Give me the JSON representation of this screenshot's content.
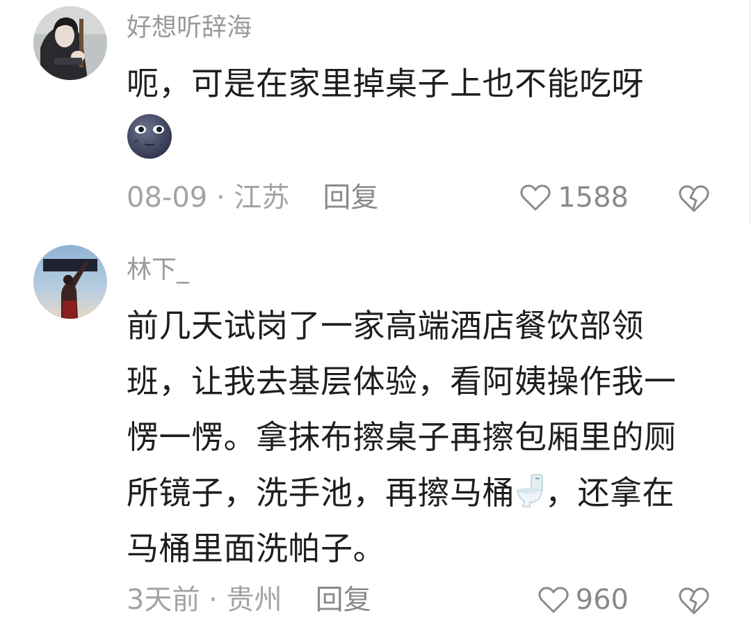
{
  "comments": [
    {
      "username": "好想听辞海",
      "avatar_icon": "avatar-girl-instrument",
      "text": "呃，可是在家里掉桌子上也不能吃呀",
      "emoji": "new-moon-face-emoji",
      "date": "08-09",
      "separator": " · ",
      "location": "江苏",
      "reply_label": "回复",
      "likes": "1588"
    },
    {
      "username": "林下_",
      "avatar_icon": "avatar-silhouette-sky",
      "text_before_emoji": "前几天试岗了一家高端酒店餐饮部领班，让我去基层体验，看阿姨操作我一愣一愣。拿抹布擦桌子再擦包厢里的厕所镜子，洗手池，再擦马桶",
      "emoji": "toilet-emoji",
      "text_after_emoji": "，还拿在马桶里面洗帕子。",
      "date": "3天前",
      "separator": " · ",
      "location": "贵州",
      "reply_label": "回复",
      "likes": "960"
    }
  ],
  "colors": {
    "meta_text": "#a3a3a3",
    "username": "#9a9a9a",
    "body_text": "#1e1e1e"
  }
}
